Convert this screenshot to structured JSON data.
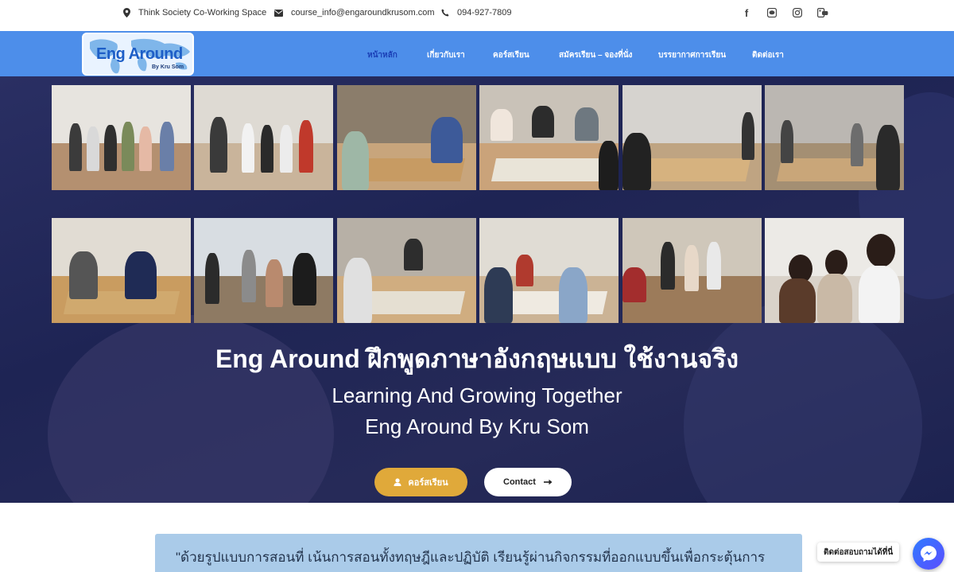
{
  "topbar": {
    "address": "Think Society Co-Working Space",
    "email": "course_info@engaroundkrusom.com",
    "phone": "094-927-7809",
    "social_icons": [
      "facebook-icon",
      "line-icon",
      "instagram-icon",
      "line-official-icon"
    ]
  },
  "logo": {
    "title": "Eng Around",
    "subtitle": "By Kru Som"
  },
  "nav": {
    "items": [
      {
        "label": "หน้าหลัก",
        "active": true
      },
      {
        "label": "เกี่ยวกับเรา",
        "active": false
      },
      {
        "label": "คอร์สเรียน",
        "active": false
      },
      {
        "label": "สมัครเรียน – จองที่นั่ง",
        "active": false
      },
      {
        "label": "บรรยากาศการเรียน",
        "active": false
      },
      {
        "label": "ติดต่อเรา",
        "active": false
      }
    ]
  },
  "hero": {
    "title": "Eng Around ฝึกพูดภาษาอังกฤษแบบ ใช้งานจริง",
    "subtitle_line1": "Learning And Growing Together",
    "subtitle_line2": "Eng Around By Kru Som",
    "course_button": "คอร์สเรียน",
    "contact_button": "Contact"
  },
  "quote": {
    "text": "\"ด้วยรูปแบบการสอนที่ เน้นการสอนทั้งทฤษฎีและปฏิบัติ เรียนรู้ผ่านกิจกรรมที่ออกแบบขึ้นเพื่อกระตุ้นการ"
  },
  "chat": {
    "label": "ติดต่อสอบถามได้ที่นี่"
  },
  "colors": {
    "nav_bg": "#4d8eea",
    "nav_active": "#1a3fb6",
    "hero_bg": "#1e2454",
    "course_button": "#e0a93a",
    "quote_bg": "#aacbe9",
    "messenger": "#2f7bff"
  }
}
